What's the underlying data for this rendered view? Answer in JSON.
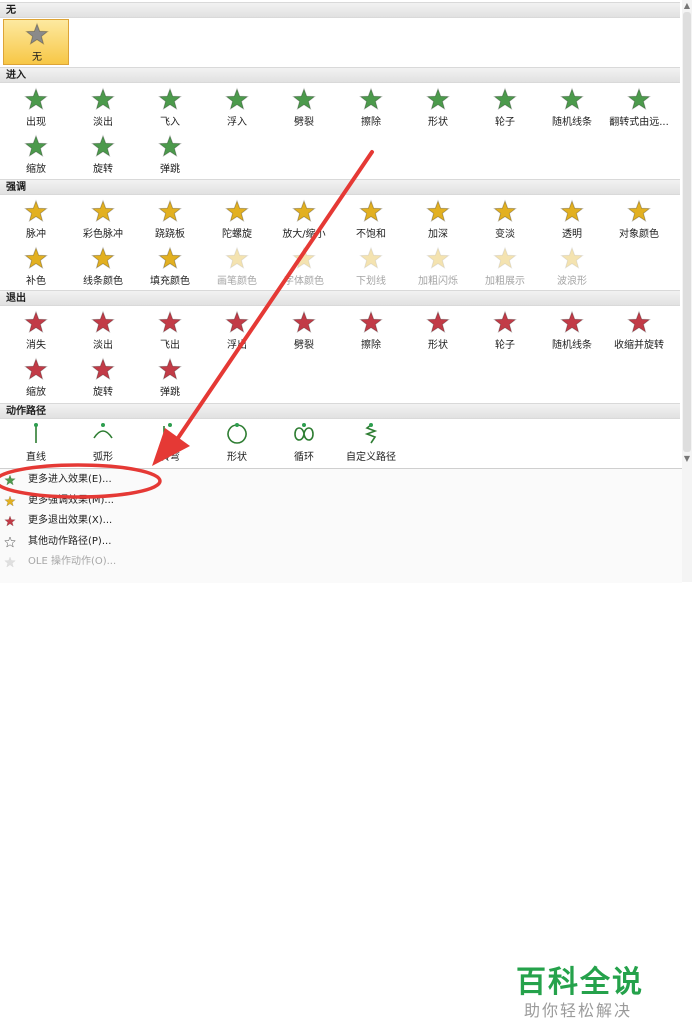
{
  "sections": [
    {
      "title": "无",
      "items": [
        {
          "label": "无",
          "selected": true,
          "kind": "none"
        }
      ]
    },
    {
      "title": "进入",
      "items": [
        {
          "label": "出现"
        },
        {
          "label": "淡出"
        },
        {
          "label": "飞入"
        },
        {
          "label": "浮入"
        },
        {
          "label": "劈裂"
        },
        {
          "label": "擦除"
        },
        {
          "label": "形状"
        },
        {
          "label": "轮子"
        },
        {
          "label": "随机线条"
        },
        {
          "label": "翻转式由远..."
        },
        {
          "label": "缩放"
        },
        {
          "label": "旋转"
        },
        {
          "label": "弹跳"
        }
      ]
    },
    {
      "title": "强调",
      "items": [
        {
          "label": "脉冲"
        },
        {
          "label": "彩色脉冲"
        },
        {
          "label": "跷跷板"
        },
        {
          "label": "陀螺旋"
        },
        {
          "label": "放大/缩小"
        },
        {
          "label": "不饱和"
        },
        {
          "label": "加深"
        },
        {
          "label": "变淡"
        },
        {
          "label": "透明"
        },
        {
          "label": "对象颜色"
        },
        {
          "label": "补色"
        },
        {
          "label": "线条颜色"
        },
        {
          "label": "填充颜色"
        },
        {
          "label": "画笔颜色",
          "disabled": true
        },
        {
          "label": "字体颜色",
          "disabled": true
        },
        {
          "label": "下划线",
          "disabled": true
        },
        {
          "label": "加粗闪烁",
          "disabled": true
        },
        {
          "label": "加粗展示",
          "disabled": true
        },
        {
          "label": "波浪形",
          "disabled": true
        }
      ]
    },
    {
      "title": "退出",
      "items": [
        {
          "label": "消失"
        },
        {
          "label": "淡出"
        },
        {
          "label": "飞出"
        },
        {
          "label": "浮出"
        },
        {
          "label": "劈裂"
        },
        {
          "label": "擦除"
        },
        {
          "label": "形状"
        },
        {
          "label": "轮子"
        },
        {
          "label": "随机线条"
        },
        {
          "label": "收缩并旋转"
        },
        {
          "label": "缩放"
        },
        {
          "label": "旋转"
        },
        {
          "label": "弹跳"
        }
      ]
    },
    {
      "title": "动作路径",
      "items": [
        {
          "label": "直线"
        },
        {
          "label": "弧形"
        },
        {
          "label": "转弯"
        },
        {
          "label": "形状"
        },
        {
          "label": "循环"
        },
        {
          "label": "自定义路径"
        }
      ]
    }
  ],
  "more_effects": [
    {
      "label": "更多进入效果(E)...",
      "icon": "green-star-icon"
    },
    {
      "label": "更多强调效果(M)...",
      "icon": "gold-star-icon"
    },
    {
      "label": "更多退出效果(X)...",
      "icon": "red-star-icon"
    },
    {
      "label": "其他动作路径(P)...",
      "icon": "outline-star-icon"
    },
    {
      "label": "OLE 操作动作(O)...",
      "icon": "ole-action-icon",
      "disabled": true
    }
  ],
  "watermark": {
    "title": "百科全说",
    "subtitle": "助你轻松解决"
  },
  "colors": {
    "entrance": "#4c9a4c",
    "emphasis": "#e2b021",
    "exit": "#c23b47",
    "path": "#2e7d32",
    "annotation": "#e53935",
    "brand": "#25a24b"
  }
}
